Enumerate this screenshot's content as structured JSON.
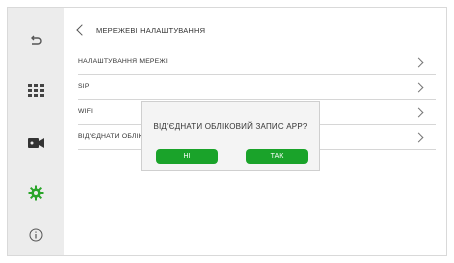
{
  "header": {
    "title": "МЕРЕЖЕВІ НАЛАШТУВАННЯ"
  },
  "settings": {
    "items": [
      {
        "label": "НАЛАШТУВАННЯ МЕРЕЖІ"
      },
      {
        "label": "SIP"
      },
      {
        "label": "WIFI"
      },
      {
        "label": "ВІД'ЄДНАТИ ОБЛІКОВИЙ ЗАПИС APP"
      }
    ]
  },
  "sidebar": {
    "icons": [
      "back-arrow-icon",
      "grid-icon",
      "camera-icon",
      "gear-icon",
      "info-icon"
    ],
    "active_color": "#2aa52a"
  },
  "dialog": {
    "message": "ВІД'ЄДНАТИ ОБЛІКОВИЙ ЗАПИС APP?",
    "no_label": "НІ",
    "yes_label": "ТАК",
    "button_color": "#1aa32a"
  }
}
